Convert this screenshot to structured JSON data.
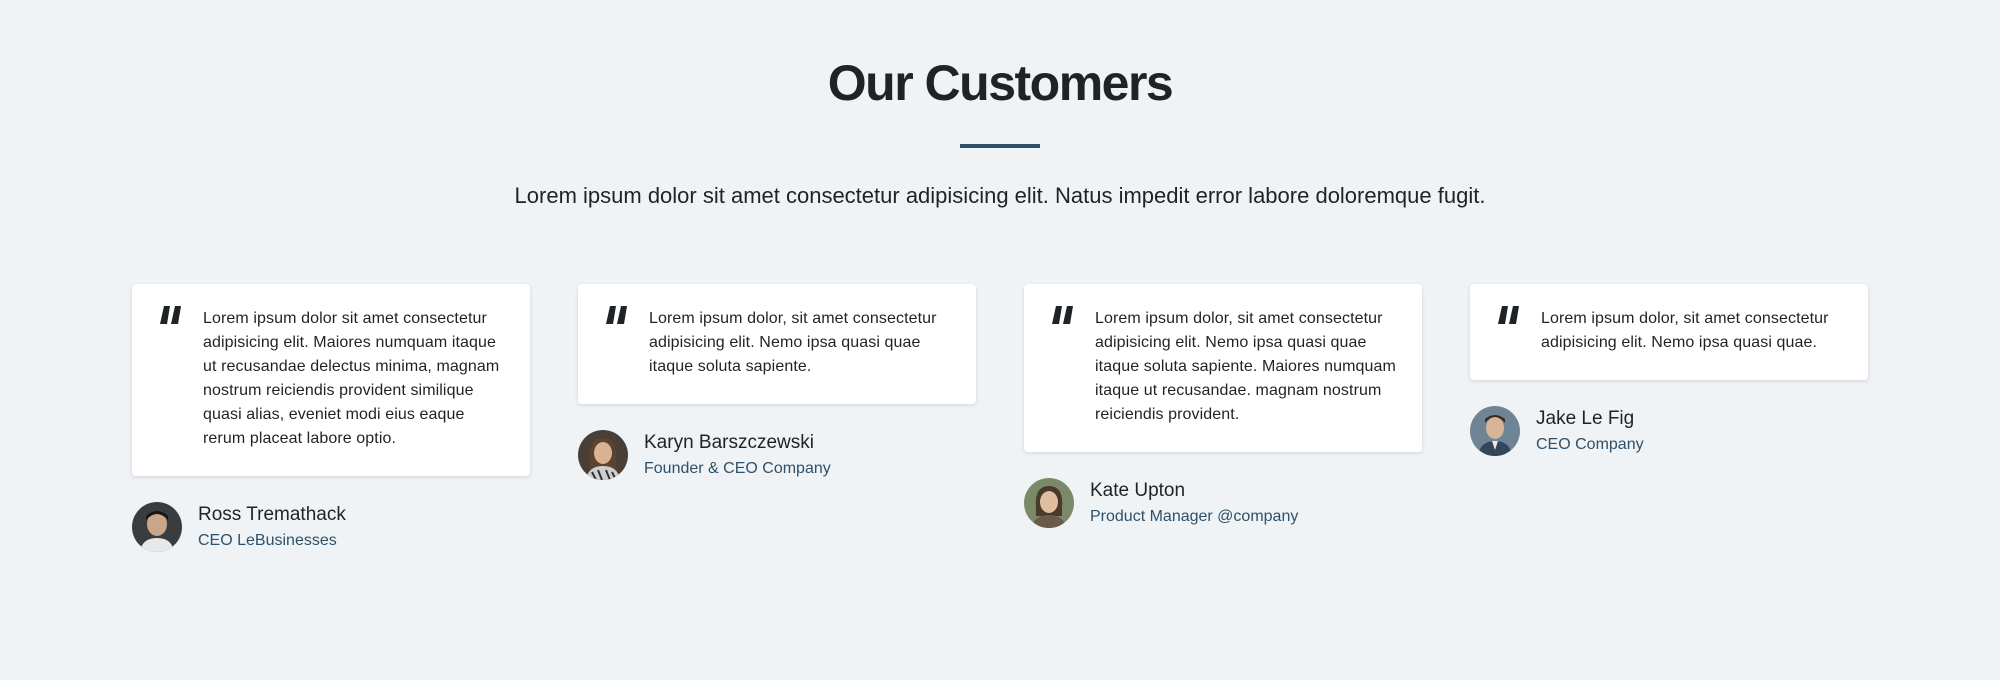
{
  "section": {
    "title": "Our Customers",
    "subtitle": "Lorem ipsum dolor sit amet consectetur adipisicing elit. Natus impedit error labore doloremque fugit."
  },
  "colors": {
    "background": "#eff3f6",
    "accent": "#2f5068",
    "text": "#1f2326",
    "card": "#ffffff"
  },
  "testimonials": [
    {
      "quote": "Lorem ipsum dolor sit amet consectetur adipisicing elit. Maiores numquam itaque ut recusandae delectus minima, magnam nostrum reiciendis provident similique quasi alias, eveniet modi eius eaque rerum placeat labore optio.",
      "name": "Ross Tremathack",
      "role": "CEO LeBusinesses",
      "icon": "quote-icon"
    },
    {
      "quote": "Lorem ipsum dolor, sit amet consectetur adipisicing elit. Nemo ipsa quasi quae itaque soluta sapiente.",
      "name": "Karyn Barszczewski",
      "role": "Founder & CEO Company",
      "icon": "quote-icon"
    },
    {
      "quote": "Lorem ipsum dolor, sit amet consectetur adipisicing elit. Nemo ipsa quasi quae itaque soluta sapiente. Maiores numquam itaque ut recusandae. magnam nostrum reiciendis provident.",
      "name": "Kate Upton",
      "role": "Product Manager @company",
      "icon": "quote-icon"
    },
    {
      "quote": "Lorem ipsum dolor, sit amet consectetur adipisicing elit. Nemo ipsa quasi quae.",
      "name": "Jake Le Fig",
      "role": "CEO Company",
      "icon": "quote-icon"
    }
  ]
}
